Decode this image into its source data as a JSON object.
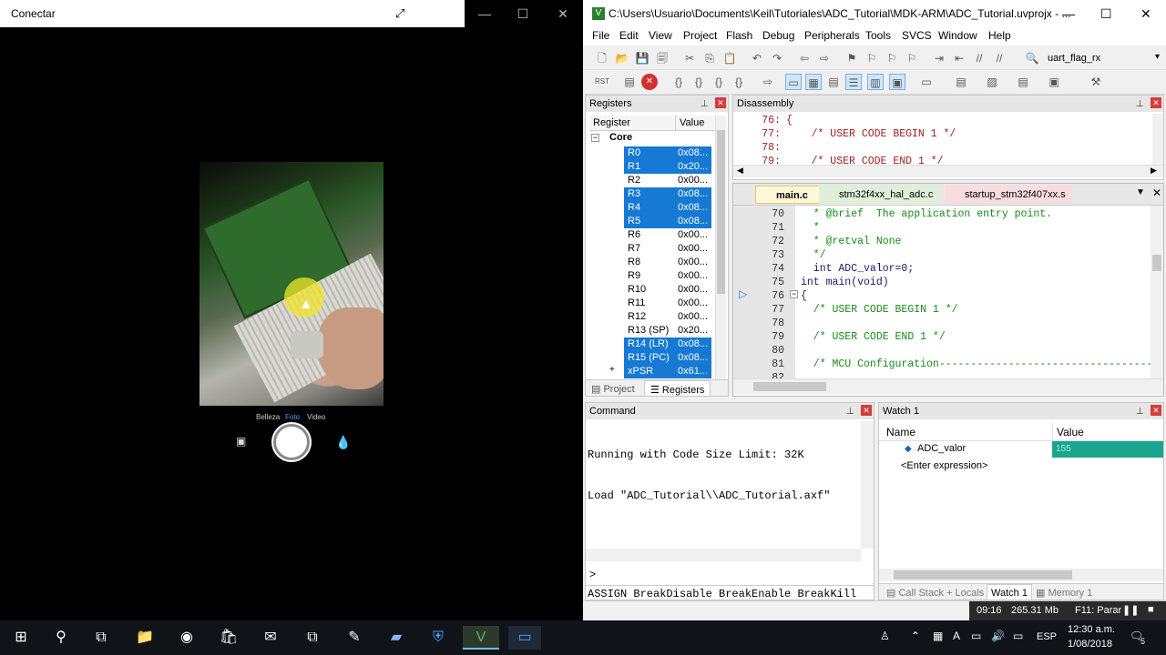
{
  "left_app": {
    "title": "Conectar",
    "expand_icon": "expand-icon",
    "camera": {
      "modes": [
        "Belleza",
        "Foto",
        "Video"
      ],
      "active_mode": "Foto",
      "icons": [
        "flash-icon",
        "rotate-camera-icon",
        "menu-icon",
        "gallery-icon",
        "filter-icon"
      ]
    }
  },
  "keil": {
    "title": "C:\\Users\\Usuario\\Documents\\Keil\\Tutoriales\\ADC_Tutorial\\MDK-ARM\\ADC_Tutorial.uvprojx - ...",
    "menu": [
      "File",
      "Edit",
      "View",
      "Project",
      "Flash",
      "Debug",
      "Peripherals",
      "Tools",
      "SVCS",
      "Window",
      "Help"
    ],
    "toolbar_target": "uart_flag_rx",
    "registers": {
      "title": "Registers",
      "col_register": "Register",
      "col_value": "Value",
      "group": "Core",
      "rows": [
        {
          "name": "R0",
          "value": "0x08...",
          "selected": true
        },
        {
          "name": "R1",
          "value": "0x20...",
          "selected": true
        },
        {
          "name": "R2",
          "value": "0x00...",
          "selected": false
        },
        {
          "name": "R3",
          "value": "0x08...",
          "selected": true
        },
        {
          "name": "R4",
          "value": "0x08...",
          "selected": true
        },
        {
          "name": "R5",
          "value": "0x08...",
          "selected": true
        },
        {
          "name": "R6",
          "value": "0x00...",
          "selected": false
        },
        {
          "name": "R7",
          "value": "0x00...",
          "selected": false
        },
        {
          "name": "R8",
          "value": "0x00...",
          "selected": false
        },
        {
          "name": "R9",
          "value": "0x00...",
          "selected": false
        },
        {
          "name": "R10",
          "value": "0x00...",
          "selected": false
        },
        {
          "name": "R11",
          "value": "0x00...",
          "selected": false
        },
        {
          "name": "R12",
          "value": "0x00...",
          "selected": false
        },
        {
          "name": "R13 (SP)",
          "value": "0x20...",
          "selected": false
        },
        {
          "name": "R14 (LR)",
          "value": "0x08...",
          "selected": true
        },
        {
          "name": "R15 (PC)",
          "value": "0x08...",
          "selected": true
        },
        {
          "name": "xPSR",
          "value": "0x61...",
          "selected": true
        }
      ],
      "tabs": [
        "Project",
        "Registers"
      ]
    },
    "disassembly": {
      "title": "Disassembly",
      "lines": [
        {
          "num": "76:",
          "text": "{"
        },
        {
          "num": "77:",
          "text": "    /* USER CODE BEGIN 1 */"
        },
        {
          "num": "78:",
          "text": ""
        },
        {
          "num": "79:",
          "text": "    /* USER CODE END 1 */"
        }
      ]
    },
    "editor": {
      "tabs": [
        "main.c",
        "stm32f4xx_hal_adc.c",
        "startup_stm32f407xx.s"
      ],
      "lines": [
        {
          "num": "70",
          "text": "  * @brief  The application entry point.",
          "kind": "comment"
        },
        {
          "num": "71",
          "text": "  *",
          "kind": "comment"
        },
        {
          "num": "72",
          "text": "  * @retval None",
          "kind": "comment"
        },
        {
          "num": "73",
          "text": "  */",
          "kind": "comment"
        },
        {
          "num": "74",
          "text": "  int ADC_valor=0;",
          "kind": "code"
        },
        {
          "num": "75",
          "text": "int main(void)",
          "kind": "code"
        },
        {
          "num": "76",
          "text": "{",
          "kind": "code"
        },
        {
          "num": "77",
          "text": "  /* USER CODE BEGIN 1 */",
          "kind": "comment"
        },
        {
          "num": "78",
          "text": "",
          "kind": "code"
        },
        {
          "num": "79",
          "text": "  /* USER CODE END 1 */",
          "kind": "comment"
        },
        {
          "num": "80",
          "text": "",
          "kind": "code"
        },
        {
          "num": "81",
          "text": "  /* MCU Configuration----------------------------------------",
          "kind": "comment"
        },
        {
          "num": "82",
          "text": "",
          "kind": "code"
        }
      ]
    },
    "command": {
      "title": "Command",
      "output": [
        "Running with Code Size Limit: 32K",
        "Load \"ADC_Tutorial\\\\ADC_Tutorial.axf\""
      ],
      "prompt": ">",
      "help": "ASSIGN BreakDisable BreakEnable BreakKill"
    },
    "watch": {
      "title": "Watch 1",
      "col_name": "Name",
      "col_value": "Value",
      "var_name": "ADC_valor",
      "var_value": "155",
      "enter_expression": "<Enter expression>",
      "tabs": [
        "Call Stack + Locals",
        "Watch 1",
        "Memory 1"
      ]
    },
    "status": {
      "time": "09:16",
      "mem": "265.31 Mb",
      "f11": "F11: Parar"
    }
  },
  "taskbar": {
    "time": "12:30 a.m.",
    "date": "1/08/2018",
    "lang": "ESP",
    "notifications": "5"
  },
  "colors": {
    "selection": "#1679d4",
    "watch_value_bg": "#1aa58f",
    "close_red": "#d83b3b"
  }
}
